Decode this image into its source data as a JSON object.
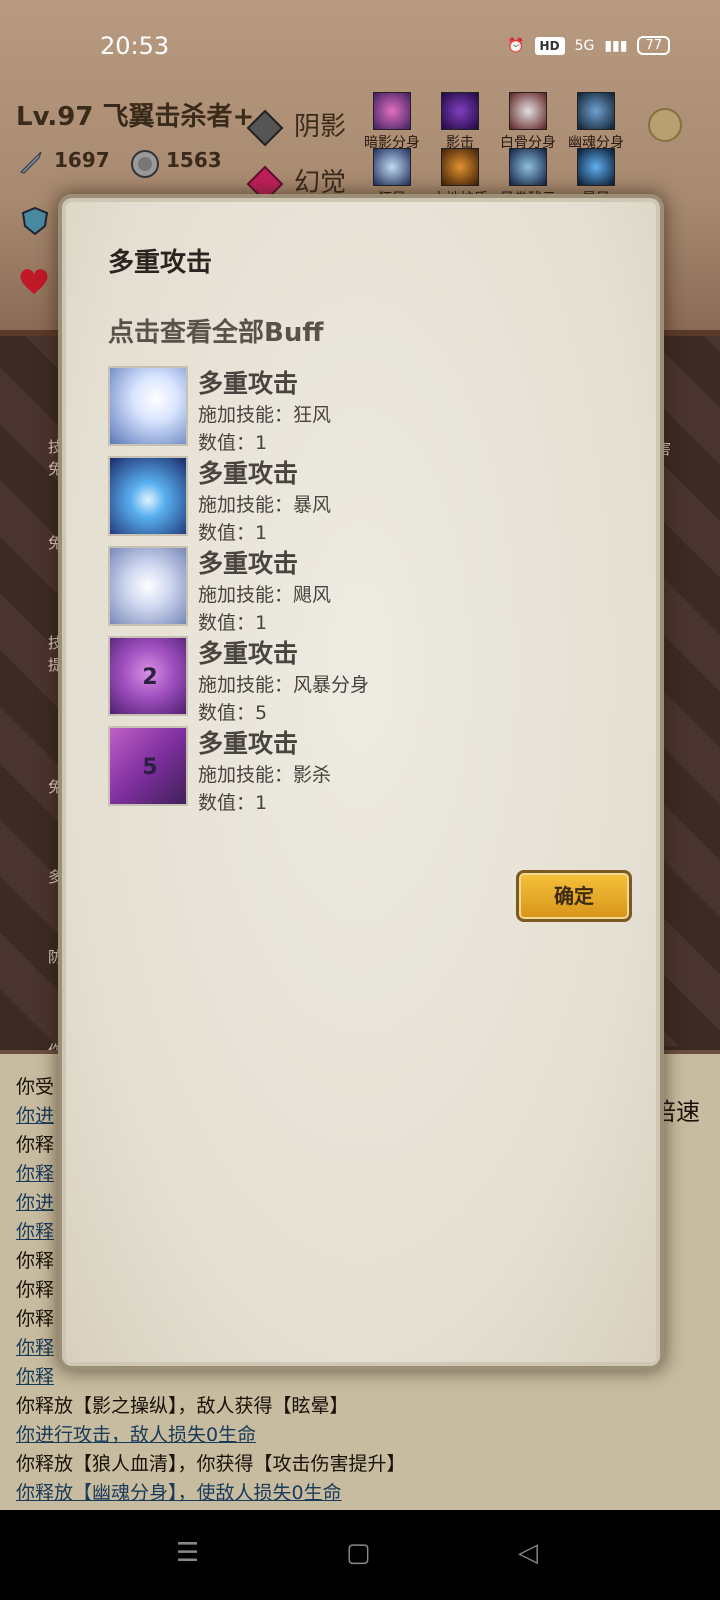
{
  "status_bar": {
    "time": "20:53",
    "hd": "HD",
    "network": "5G",
    "battery": "77"
  },
  "header": {
    "level_title": "Lv.97 飞翼击杀者+",
    "attack_value": "1697",
    "coin_value": "1563",
    "class_1": "阴影",
    "class_2": "幻觉",
    "skills_row1": [
      "暗影分身",
      "影击",
      "白骨分身",
      "幽魂分身"
    ],
    "skills_row2": [
      "狂风",
      "大地护盾",
      "风卷残云",
      "暴风"
    ]
  },
  "background_side_text": [
    "技",
    "免",
    "免",
    "技",
    "提",
    "免",
    "多",
    "防",
    "伤"
  ],
  "background_right_text": "害",
  "battle_log": {
    "speed_label": "倍速",
    "lines": [
      {
        "text": "你受",
        "u": false
      },
      {
        "text": "你进",
        "u": true
      },
      {
        "text": "你释",
        "u": false
      },
      {
        "text": "你释",
        "u": true
      },
      {
        "text": "你进",
        "u": true
      },
      {
        "text": "你释",
        "u": true
      },
      {
        "text": "你释",
        "u": false
      },
      {
        "text": "你释",
        "u": false
      },
      {
        "text": "你释",
        "u": false
      },
      {
        "text": "你释",
        "u": true
      },
      {
        "text": "你释",
        "u": true
      },
      {
        "text": "你释放【影之操纵】，敌人获得【眩晕】",
        "u": false
      },
      {
        "text": "你进行攻击，敌人损失0生命",
        "u": true
      },
      {
        "text": "你释放【狼人血清】，你获得【攻击伤害提升】",
        "u": false
      },
      {
        "text": "你释放【幽魂分身】，使敌人损失0生命",
        "u": true
      }
    ]
  },
  "dialog": {
    "title": "多重攻击",
    "view_all_link": "点击查看全部Buff",
    "confirm_label": "确定",
    "buffs": [
      {
        "name": "多重攻击",
        "skill": "施加技能：狂风",
        "value": "数值：1",
        "badge": ""
      },
      {
        "name": "多重攻击",
        "skill": "施加技能：暴风",
        "value": "数值：1",
        "badge": ""
      },
      {
        "name": "多重攻击",
        "skill": "施加技能：飓风",
        "value": "数值：1",
        "badge": ""
      },
      {
        "name": "多重攻击",
        "skill": "施加技能：风暴分身",
        "value": "数值：5",
        "badge": "2"
      },
      {
        "name": "多重攻击",
        "skill": "施加技能：影杀",
        "value": "数值：1",
        "badge": "5"
      }
    ]
  }
}
